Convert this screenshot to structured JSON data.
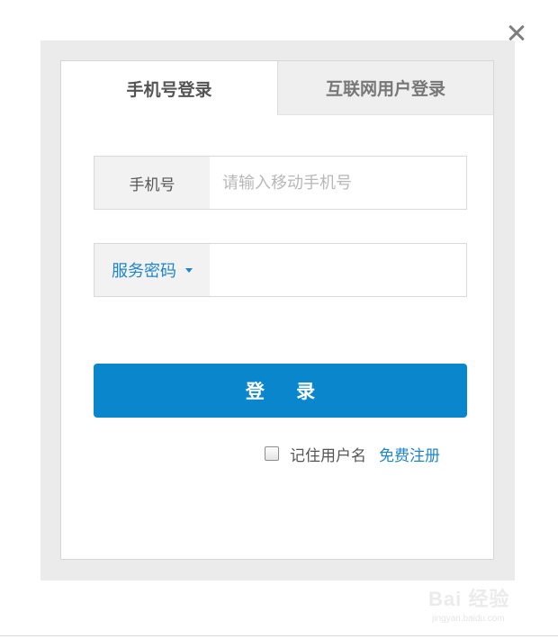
{
  "tabs": [
    {
      "label": "手机号登录",
      "active": true
    },
    {
      "label": "互联网用户登录",
      "active": false
    }
  ],
  "phone_field": {
    "label": "手机号",
    "value": "",
    "placeholder": "请输入移动手机号"
  },
  "password_field": {
    "selector_label": "服务密码",
    "value": "",
    "placeholder": ""
  },
  "login_button": {
    "label": "登 录"
  },
  "remember": {
    "label": "记住用户名",
    "checked": false
  },
  "register_link": {
    "label": "免费注册"
  },
  "watermark": {
    "brand": "Bai 经验",
    "url": "jingyan.baidu.com"
  },
  "colors": {
    "accent": "#0a86cd",
    "link": "#1e86c8",
    "frame": "#ebebeb"
  },
  "icons": {
    "close": "close-icon",
    "dropdown": "caret-down-icon"
  }
}
